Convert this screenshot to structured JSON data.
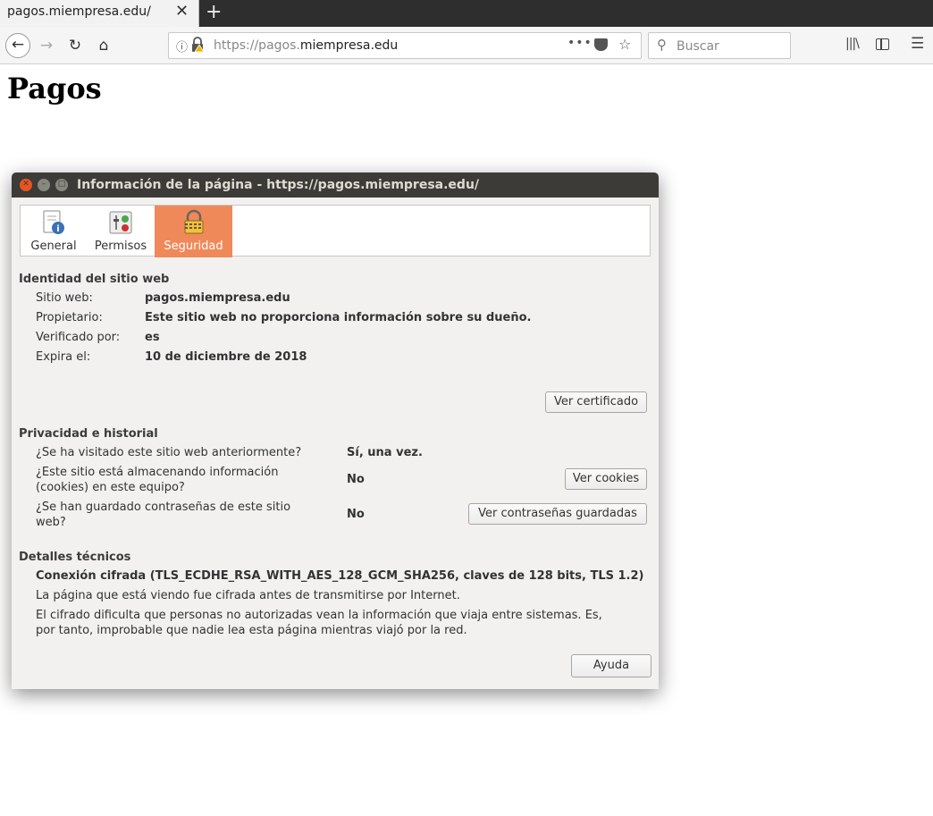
{
  "browser": {
    "tab_title": "pagos.miempresa.edu/",
    "tab_close": "✕",
    "new_tab": "+",
    "url_prefix": "https://pagos.",
    "url_domain": "miempresa.edu",
    "url_dots": "•••",
    "search_placeholder": "Buscar",
    "back_glyph": "←",
    "forward_glyph": "→",
    "reload_glyph": "↻",
    "home_glyph": "⌂",
    "star_glyph": "☆",
    "menu_glyph": "☰",
    "library_glyph": "|||\\"
  },
  "page": {
    "heading": "Pagos"
  },
  "dialog": {
    "title": "Información de la página - https://pagos.miempresa.edu/",
    "tabs": [
      {
        "label": "General",
        "icon": "info-icon"
      },
      {
        "label": "Permisos",
        "icon": "permissions-icon"
      },
      {
        "label": "Seguridad",
        "icon": "lock-icon",
        "active": true
      }
    ],
    "identity": {
      "heading": "Identidad del sitio web",
      "site_label": "Sitio web:",
      "site_value": "pagos.miempresa.edu",
      "owner_label": "Propietario:",
      "owner_value": "Este sitio web no proporciona información sobre su dueño.",
      "verified_label": "Verificado por:",
      "verified_value": "es",
      "expires_label": "Expira el:",
      "expires_value": "10 de diciembre de 2018",
      "cert_button": "Ver certificado"
    },
    "privacy": {
      "heading": "Privacidad e historial",
      "visited_q": "¿Se ha visitado este sitio web anteriormente?",
      "visited_a": "Sí, una vez.",
      "cookies_q1": "¿Este sitio está almacenando información",
      "cookies_q2": "(cookies) en este equipo?",
      "cookies_a": "No",
      "cookies_button": "Ver cookies",
      "passwords_q1": "¿Se han guardado contraseñas de este sitio",
      "passwords_q2": "web?",
      "passwords_a": "No",
      "passwords_button": "Ver contraseñas guardadas"
    },
    "technical": {
      "heading": "Detalles técnicos",
      "connection": "Conexión cifrada (TLS_ECDHE_RSA_WITH_AES_128_GCM_SHA256, claves de 128 bits, TLS 1.2)",
      "line1": "La página que está viendo fue cifrada antes de transmitirse por Internet.",
      "line2": "El cifrado dificulta que personas no autorizadas vean la información que viaja entre sistemas. Es,",
      "line3": "por tanto, improbable que nadie lea esta página mientras viajó por la red."
    },
    "help_button": "Ayuda"
  },
  "colors": {
    "active_tab": "#f0895a",
    "titlebar": "#3c3b37",
    "close_button": "#e9541f"
  }
}
